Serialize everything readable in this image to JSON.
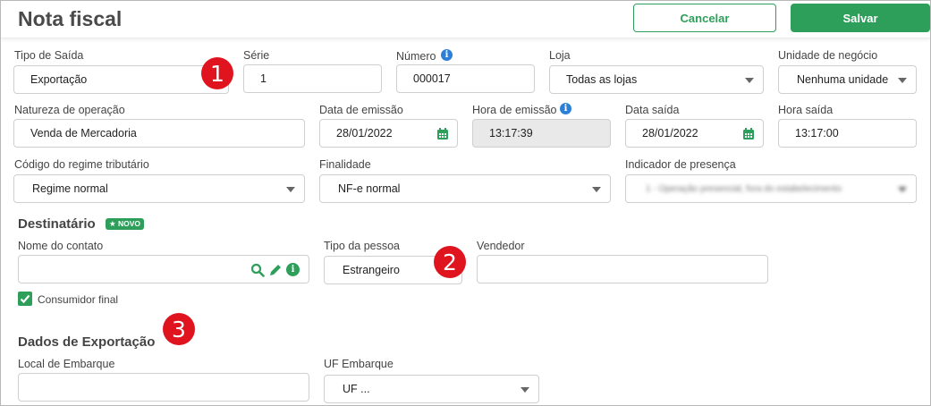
{
  "header": {
    "title": "Nota fiscal",
    "cancel_label": "Cancelar",
    "save_label": "Salvar"
  },
  "row1": {
    "tipo_saida": {
      "label": "Tipo de Saída",
      "value": "Exportação"
    },
    "serie": {
      "label": "Série",
      "value": "1"
    },
    "numero": {
      "label": "Número",
      "value": "000017"
    },
    "loja": {
      "label": "Loja",
      "value": "Todas as lojas"
    },
    "unidade": {
      "label": "Unidade de negócio",
      "value": "Nenhuma unidade"
    }
  },
  "row2": {
    "natureza": {
      "label": "Natureza de operação",
      "value": "Venda de Mercadoria"
    },
    "data_emissao": {
      "label": "Data de emissão",
      "value": "28/01/2022"
    },
    "hora_emissao": {
      "label": "Hora de emissão",
      "value": "13:17:39"
    },
    "data_saida": {
      "label": "Data saída",
      "value": "28/01/2022"
    },
    "hora_saida": {
      "label": "Hora saída",
      "value": "13:17:00"
    }
  },
  "row3": {
    "regime": {
      "label": "Código do regime tributário",
      "value": "Regime normal"
    },
    "finalidade": {
      "label": "Finalidade",
      "value": "NF-e normal"
    },
    "presenca": {
      "label": "Indicador de presença",
      "value": "1 - Operação presencial, fora do estabelecimento"
    }
  },
  "destinatario": {
    "title": "Destinatário",
    "badge": "★ NOVO",
    "nome": {
      "label": "Nome do contato",
      "value": ""
    },
    "tipo_pessoa": {
      "label": "Tipo da pessoa",
      "value": "Estrangeiro"
    },
    "vendedor": {
      "label": "Vendedor",
      "value": ""
    },
    "consumidor_final": {
      "label": "Consumidor final",
      "checked": true
    }
  },
  "exportacao": {
    "title": "Dados de Exportação",
    "local": {
      "label": "Local de Embarque",
      "value": ""
    },
    "uf": {
      "label": "UF Embarque",
      "value": "UF ..."
    }
  },
  "markers": {
    "m1": "1",
    "m2": "2",
    "m3": "3"
  },
  "icons": {
    "info": "i"
  },
  "colors": {
    "accent": "#2e9e5b",
    "info": "#2b7fd6",
    "marker": "#e0141f"
  }
}
